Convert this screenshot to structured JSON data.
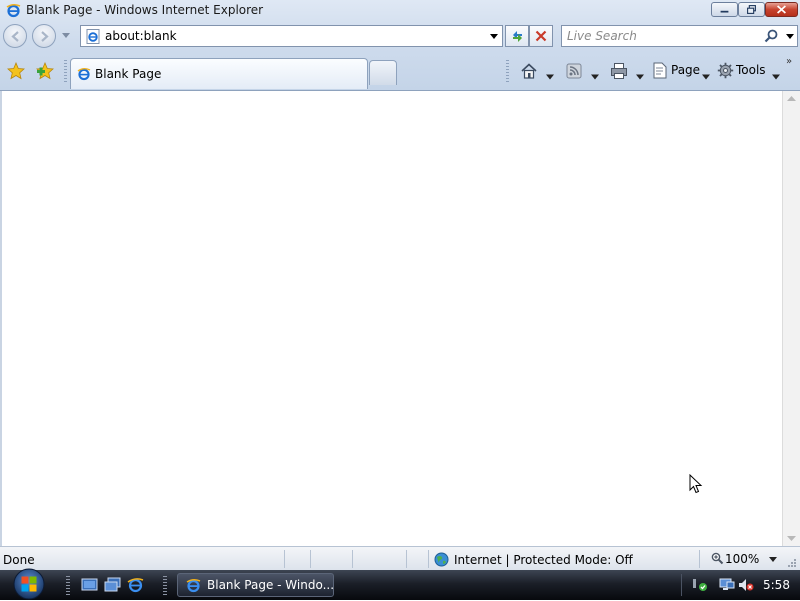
{
  "window": {
    "title": "Blank Page - Windows Internet Explorer"
  },
  "nav": {
    "address": "about:blank",
    "search_placeholder": "Live Search"
  },
  "tabs": [
    {
      "label": "Blank Page",
      "active": true
    }
  ],
  "command_bar": {
    "page_label": "Page",
    "tools_label": "Tools",
    "overflow": "»"
  },
  "status": {
    "text": "Done",
    "zone": "Internet | Protected Mode: Off",
    "zoom": "100%"
  },
  "taskbar": {
    "task_label": "Blank Page - Windo...",
    "clock": "5:58"
  },
  "colors": {
    "chrome_top": "#dfe8f4",
    "chrome_bottom": "#c4d4e8",
    "taskbar": "#1b1f28",
    "close_button": "#c7432f",
    "ie_blue": "#1c6fd6"
  }
}
